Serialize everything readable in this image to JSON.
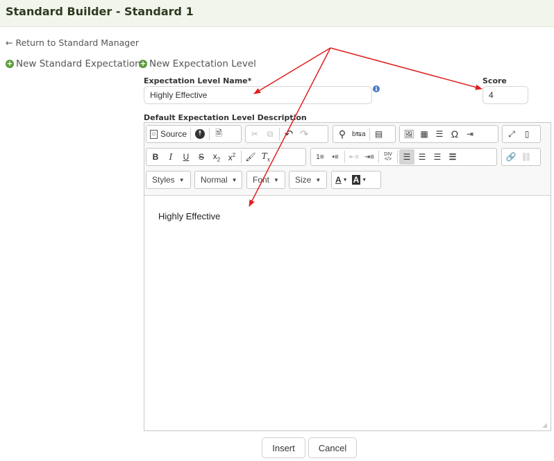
{
  "header": {
    "title": "Standard Builder - Standard 1"
  },
  "nav": {
    "return_label": "← Return to Standard Manager",
    "new_standard_expectation": "New Standard Expectation",
    "new_expectation_level": "New Expectation Level"
  },
  "form": {
    "level_name_label": "Expectation Level Name*",
    "level_name_value": "Highly Effective",
    "score_label": "Score",
    "score_value": "4",
    "description_label": "Default Expectation Level Description"
  },
  "editor": {
    "source_label": "Source",
    "styles_label": "Styles",
    "format_label": "Normal",
    "font_label": "Font",
    "size_label": "Size",
    "content": "Highly Effective"
  },
  "actions": {
    "insert": "Insert",
    "cancel": "Cancel"
  },
  "colors": {
    "arrow": "#e01f1f",
    "accent": "#5b9a3c",
    "header_bg": "#f2f5ec"
  }
}
